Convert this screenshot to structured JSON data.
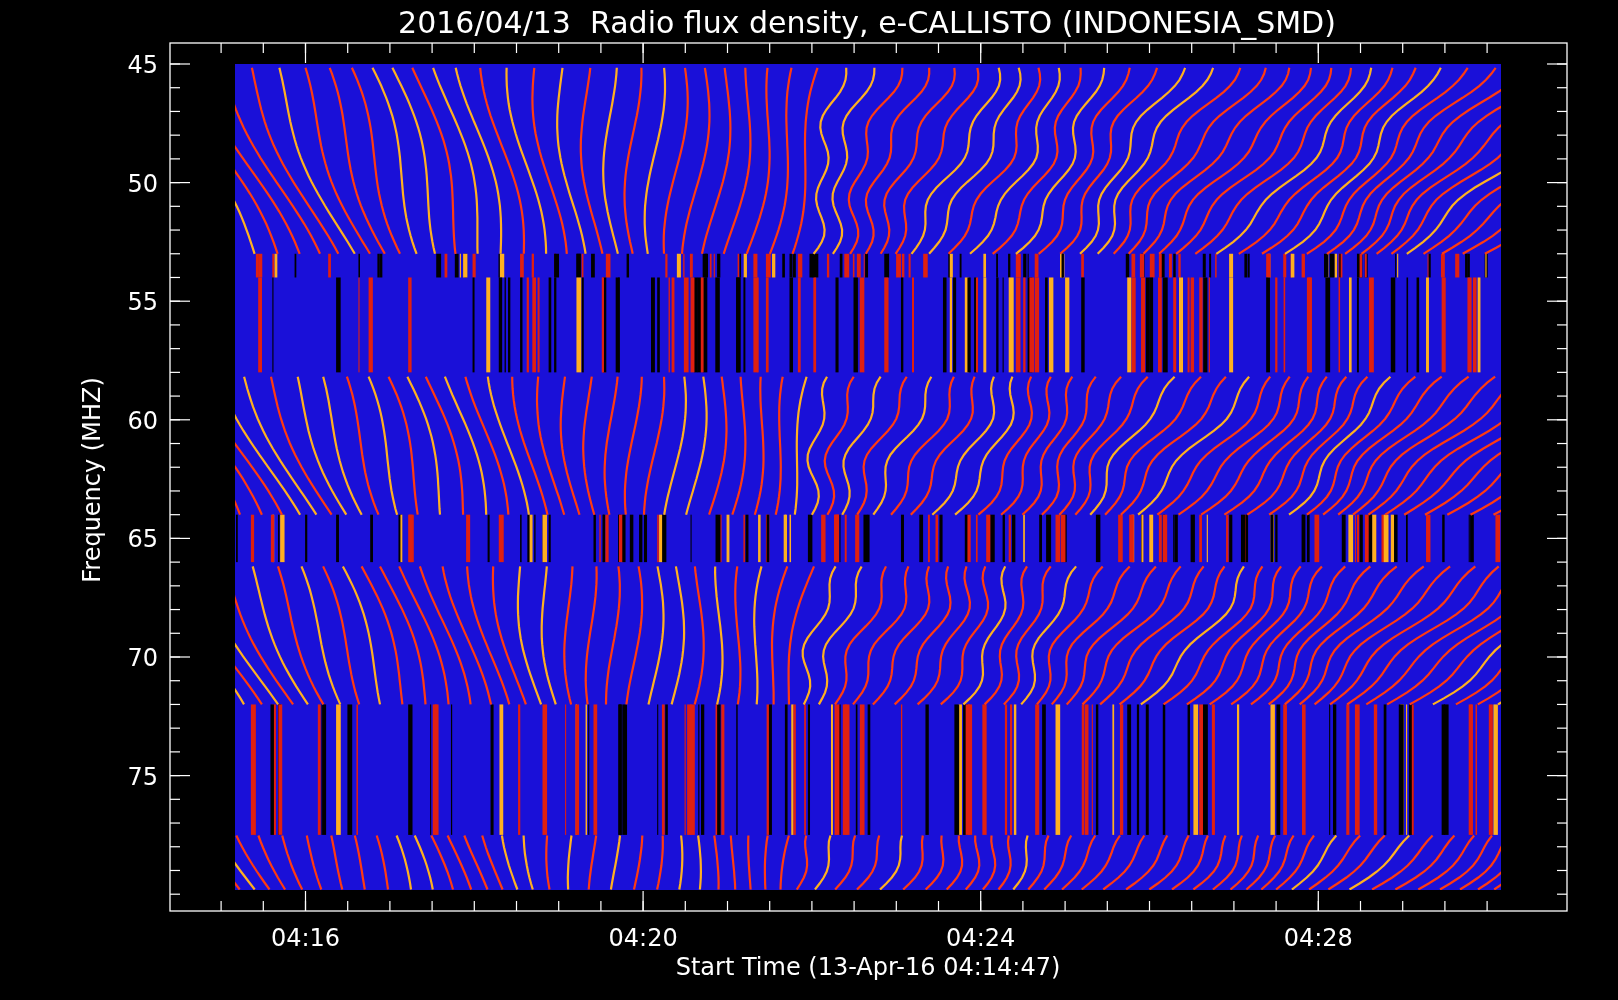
{
  "title": "2016/04/13  Radio flux density, e-CALLISTO (INDONESIA_SMD)",
  "y_axis": {
    "label": "Frequency (MHZ)",
    "ticks": [
      "45",
      "50",
      "55",
      "60",
      "65",
      "70",
      "75"
    ]
  },
  "x_axis": {
    "label": "Start Time (13-Apr-16 04:14:47)",
    "ticks": [
      "04:16",
      "04:20",
      "04:24",
      "04:28"
    ]
  }
}
